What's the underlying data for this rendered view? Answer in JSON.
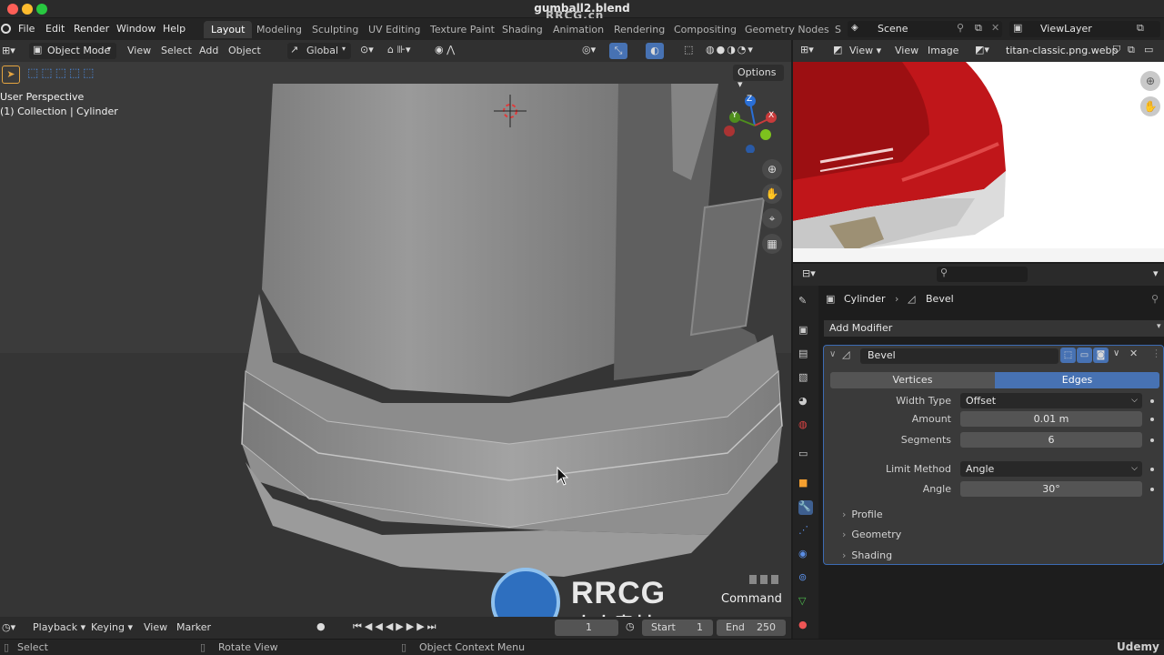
{
  "window": {
    "title": "gumball2.blend",
    "watermark": "RRCG.cn"
  },
  "topbar": {
    "menus": [
      "File",
      "Edit",
      "Render",
      "Window",
      "Help"
    ],
    "workspaces": [
      "Layout",
      "Modeling",
      "Sculpting",
      "UV Editing",
      "Texture Paint",
      "Shading",
      "Animation",
      "Rendering",
      "Compositing",
      "Geometry Nodes",
      "S"
    ],
    "active_workspace": "Layout",
    "scene": "Scene",
    "view_layer": "ViewLayer"
  },
  "viewport_header": {
    "mode": "Object Mode",
    "menus": [
      "View",
      "Select",
      "Add",
      "Object"
    ],
    "orientation": "Global",
    "options": "Options"
  },
  "viewport": {
    "info_line1": "User Perspective",
    "info_line2": "(1) Collection | Cylinder",
    "command_overlay": "Command",
    "gizmo_axes": [
      "Z",
      "Y",
      "X"
    ]
  },
  "image_editor": {
    "menus": [
      "View",
      "View",
      "Image"
    ],
    "image_name": "titan-classic.png.webp"
  },
  "properties": {
    "breadcrumb_object": "Cylinder",
    "breadcrumb_modifier": "Bevel",
    "add_modifier": "Add Modifier",
    "modifier_name": "Bevel",
    "tabs": [
      "Vertices",
      "Edges"
    ],
    "active_tab": "Edges",
    "fields": [
      {
        "label": "Width Type",
        "value": "Offset",
        "kind": "dropdown"
      },
      {
        "label": "Amount",
        "value": "0.01 m",
        "kind": "number"
      },
      {
        "label": "Segments",
        "value": "6",
        "kind": "number"
      },
      {
        "label": "Limit Method",
        "value": "Angle",
        "kind": "dropdown"
      },
      {
        "label": "Angle",
        "value": "30°",
        "kind": "number"
      }
    ],
    "subpanels": [
      "Profile",
      "Geometry",
      "Shading"
    ]
  },
  "timeline": {
    "menus": [
      "Playback",
      "Keying",
      "View",
      "Marker"
    ],
    "current_frame": "1",
    "start_label": "Start",
    "start": "1",
    "end_label": "End",
    "end": "250"
  },
  "statusbar": {
    "items": [
      "Select",
      "Rotate View",
      "Object Context Menu"
    ],
    "brand": "Udemy"
  },
  "overlay_logo": {
    "main": "RRCG",
    "sub": "人人素材"
  },
  "colors": {
    "accent_blue": "#4772b3",
    "object_orange": "#ffa033",
    "red_object": "#c0161a"
  }
}
